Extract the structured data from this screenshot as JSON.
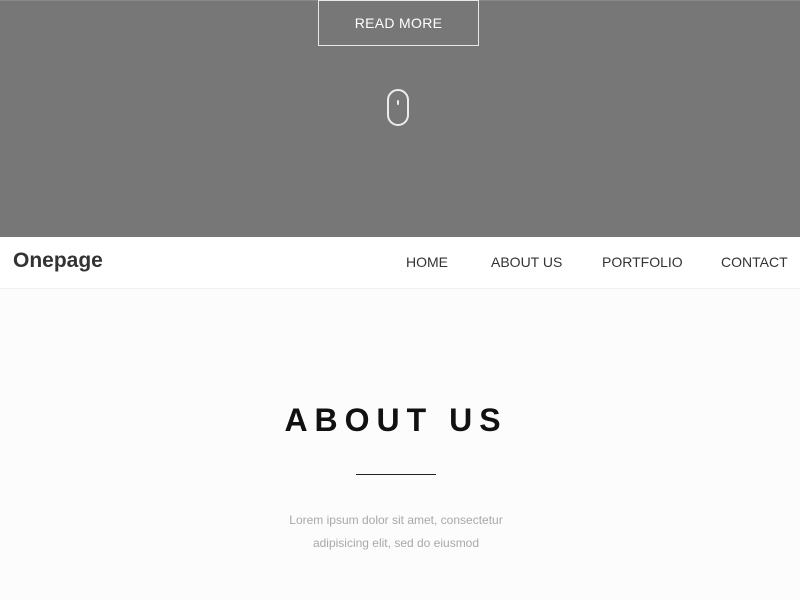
{
  "hero": {
    "read_more_label": "READ MORE",
    "scroll_icon": "mouse-scroll-icon"
  },
  "navbar": {
    "brand": "Onepage",
    "items": [
      {
        "label": "HOME"
      },
      {
        "label": "ABOUT US"
      },
      {
        "label": "PORTFOLIO"
      },
      {
        "label": "CONTACT"
      }
    ]
  },
  "about": {
    "title": "ABOUT US",
    "text_line1": "Lorem ipsum dolor sit amet, consectetur",
    "text_line2": "adipisicing elit, sed do eiusmod"
  },
  "colors": {
    "hero_bg": "#777777",
    "page_bg": "#fcfcfc",
    "nav_bg": "#ffffff",
    "text_dark": "#333333",
    "text_muted": "#a8a8a8"
  }
}
